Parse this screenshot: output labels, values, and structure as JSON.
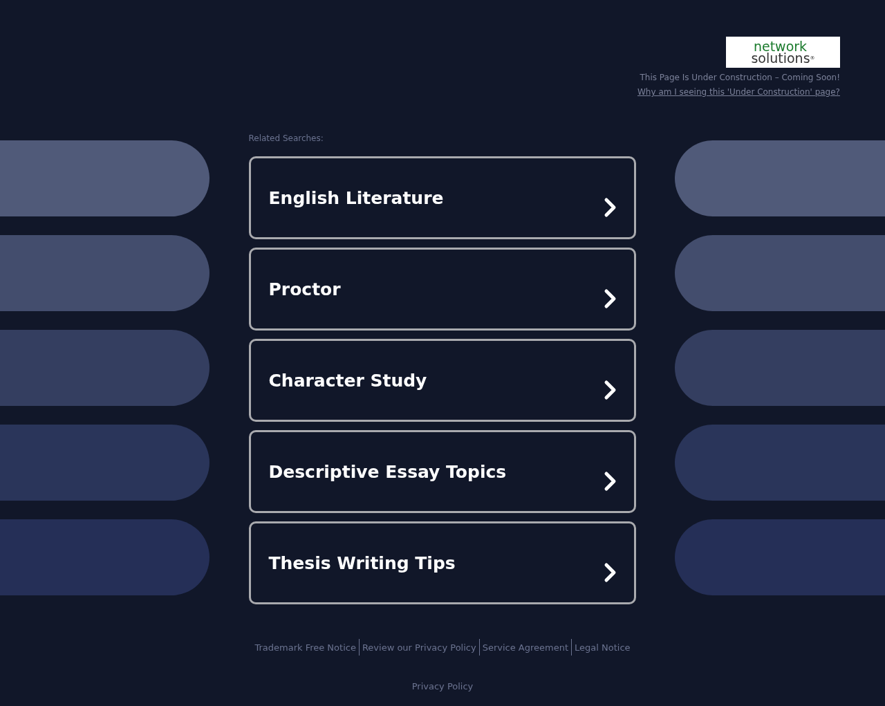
{
  "logo": {
    "line_1": "network",
    "line_2": "solutions",
    "mark": "®"
  },
  "notice": "This Page Is Under Construction – Coming Soon!",
  "why_link": "Why am I seeing this 'Under Construction' page?",
  "related_label": "Related Searches:",
  "searches": [
    {
      "label": "English Literature"
    },
    {
      "label": "Proctor"
    },
    {
      "label": "Character Study"
    },
    {
      "label": "Descriptive Essay Topics"
    },
    {
      "label": "Thesis Writing Tips"
    }
  ],
  "footer_links": [
    "Trademark Free Notice",
    "Review our Privacy Policy",
    "Service Agreement",
    "Legal Notice"
  ],
  "privacy_link": "Privacy Policy"
}
